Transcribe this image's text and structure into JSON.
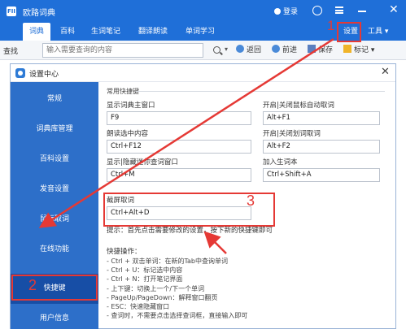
{
  "app": {
    "title": "欧路词典",
    "logo": "FII",
    "login_label": "登录",
    "settings_label": "设置",
    "tools_label": "工具",
    "tabs": [
      "词典",
      "百科",
      "生词笔记",
      "翻译朗读",
      "单词学习"
    ]
  },
  "searchbar": {
    "label": "查找",
    "placeholder": "输入需要查询的内容",
    "back_label": "返回",
    "forward_label": "前进",
    "save_label": "保存",
    "mark_label": "标记"
  },
  "dialog": {
    "title": "设置中心",
    "sidebar": [
      "常规",
      "词典库管理",
      "百科设置",
      "发音设置",
      "鼠标取词",
      "在线功能",
      "快捷键",
      "用户信息"
    ],
    "group_label": "常用快捷键",
    "fields": [
      {
        "label": "显示词典主窗口",
        "value": "F9"
      },
      {
        "label": "开启|关闭鼠标自动取词",
        "value": "Alt+F1"
      },
      {
        "label": "朗读选中内容",
        "value": "Ctrl+F12"
      },
      {
        "label": "开启|关闭划词取词",
        "value": "Alt+F2"
      },
      {
        "label": "显示|隐藏迷你查词窗口",
        "value": "Ctrl+M"
      },
      {
        "label": "加入生词本",
        "value": "Ctrl+Shift+A"
      },
      {
        "label": "截屏取词",
        "value": "Ctrl+Alt+D"
      }
    ],
    "tip": "提示：首先点击需要修改的设置，按下新的快捷键即可",
    "ops_title": "快捷操作：",
    "ops": [
      "- Ctrl + 双击单词：在新的Tab中查询单词",
      "- Ctrl + U：标记选中内容",
      "- Ctrl + N：打开笔记界面",
      "- 上下键：切换上一个/下一个单词",
      "- PageUp/PageDown：解释窗口翻页",
      "- ESC：快速隐藏窗口",
      "- 查词时，不需要点击选择查词框，直接输入即可"
    ]
  },
  "annotations": [
    "1",
    "2",
    "3"
  ],
  "colors": {
    "accent": "#1f6fd8",
    "sidebar": "#2d6fc9",
    "highlight": "#e53935"
  }
}
